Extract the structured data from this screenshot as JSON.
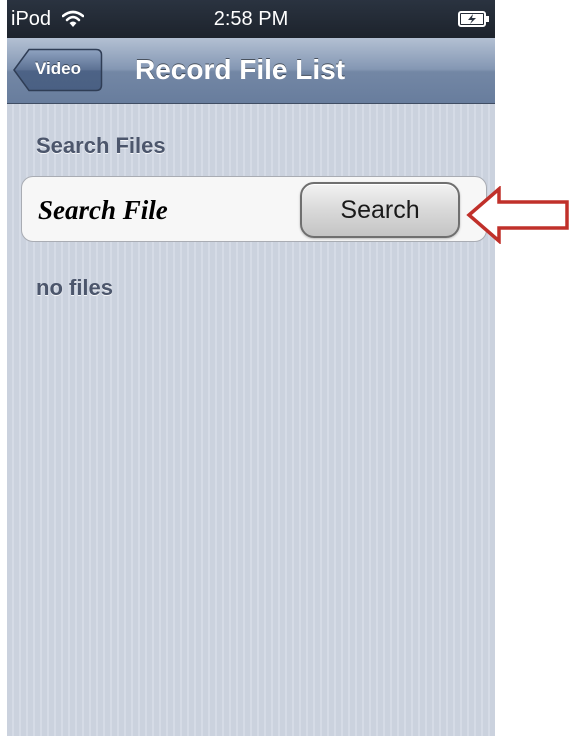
{
  "status_bar": {
    "carrier": "iPod",
    "time": "2:58 PM",
    "wifi_icon": "wifi-icon",
    "battery_icon": "battery-charging-icon"
  },
  "nav_bar": {
    "back_label": "Video",
    "title": "Record File List"
  },
  "content": {
    "section_header": "Search Files",
    "search_row": {
      "label": "Search File",
      "button_label": "Search"
    },
    "empty_message": "no files"
  },
  "annotation": {
    "icon": "left-arrow-icon",
    "color": "#c0302a"
  },
  "colors": {
    "nav_bar": "#7387a5",
    "background": "#cbd2de",
    "section_text": "#4c566c"
  }
}
